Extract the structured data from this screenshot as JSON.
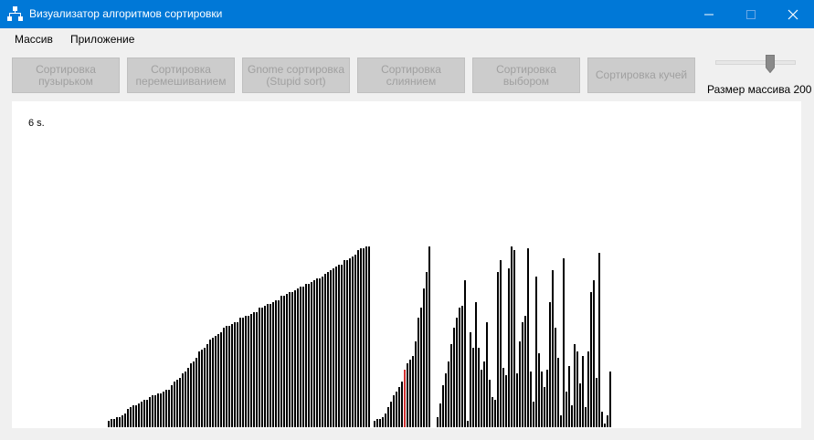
{
  "window": {
    "title": "Визуализатор алгоритмов сортировки",
    "icon": "flowchart-icon",
    "accent_color": "#0078d7"
  },
  "menu": {
    "items": [
      "Массив",
      "Приложение"
    ]
  },
  "toolbar": {
    "buttons": [
      {
        "label": "Сортировка\nпузырьком",
        "enabled": false
      },
      {
        "label": "Сортировка\nперемешиванием",
        "enabled": false
      },
      {
        "label": "Gnome сортировка\n(Stupid sort)",
        "enabled": false
      },
      {
        "label": "Сортировка\nслиянием",
        "enabled": false
      },
      {
        "label": "Сортировка\nвыбором",
        "enabled": false
      },
      {
        "label": "Сортировка кучей",
        "enabled": false
      }
    ],
    "size_slider": {
      "label": "Размер массива 200",
      "value": 200,
      "level": 0.65
    }
  },
  "visualization": {
    "timer_text": "6 s.",
    "bar_color": "#000000",
    "highlight_color": "#d03030",
    "highlight_index": 140,
    "values": [
      0,
      0,
      0,
      0,
      0,
      0,
      0,
      0,
      0,
      0,
      0,
      0,
      0,
      0,
      0,
      0,
      0,
      0,
      0,
      0,
      0,
      0,
      0,
      0,
      0,
      0,
      0,
      0,
      0,
      0,
      0,
      0,
      3,
      4,
      4,
      5,
      5,
      6,
      7,
      9,
      10,
      11,
      11,
      12,
      13,
      14,
      14,
      15,
      16,
      16,
      17,
      17,
      18,
      19,
      19,
      21,
      23,
      24,
      25,
      27,
      28,
      30,
      32,
      33,
      35,
      38,
      39,
      40,
      42,
      44,
      45,
      46,
      47,
      48,
      50,
      51,
      51,
      52,
      53,
      53,
      55,
      55,
      56,
      56,
      57,
      58,
      58,
      60,
      60,
      61,
      62,
      62,
      63,
      64,
      64,
      66,
      66,
      67,
      68,
      68,
      69,
      70,
      71,
      71,
      72,
      72,
      73,
      74,
      75,
      75,
      76,
      77,
      78,
      79,
      80,
      81,
      82,
      82,
      84,
      84,
      85,
      86,
      87,
      89,
      90,
      90,
      91,
      91,
      0,
      3,
      4,
      4,
      5,
      7,
      10,
      13,
      16,
      18,
      20,
      23,
      29,
      32,
      34,
      36,
      43,
      55,
      60,
      70,
      78,
      91,
      0,
      0,
      5,
      12,
      21,
      27,
      33,
      42,
      50,
      55,
      60,
      61,
      74,
      3,
      48,
      40,
      63,
      40,
      29,
      33,
      53,
      24,
      15,
      14,
      78,
      84,
      30,
      26,
      80,
      91,
      89,
      27,
      43,
      53,
      56,
      90,
      28,
      13,
      76,
      37,
      28,
      20,
      29,
      63,
      79,
      50,
      35,
      6,
      85,
      18,
      31,
      11,
      42,
      38,
      22,
      36,
      10,
      38,
      68,
      74,
      25,
      88,
      8,
      2,
      6,
      28
    ]
  }
}
